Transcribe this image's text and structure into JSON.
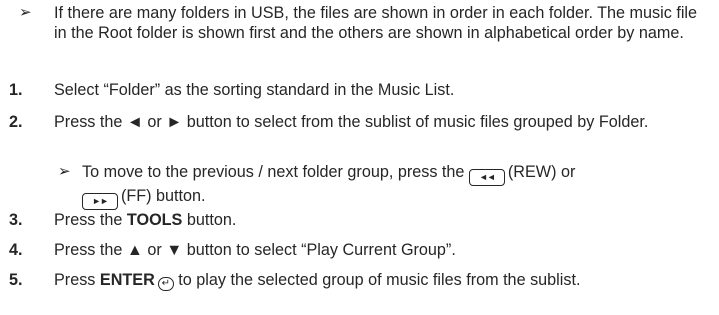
{
  "note": {
    "arrow": "➢",
    "text": "If there are many folders in USB, the files are shown in order in each folder. The music file in the Root folder is shown first and the others are shown in alphabetical order by name."
  },
  "steps": [
    {
      "num": "1.",
      "text": "Select “Folder” as the sorting standard in the Music List."
    },
    {
      "num": "2.",
      "text": "Press the ◄ or ► button to select from the sublist of music files grouped by Folder."
    },
    {
      "num": "3.",
      "pre": "Press the ",
      "bold": "TOOLS",
      "post": " button."
    },
    {
      "num": "4.",
      "text": "Press the ▲ or ▼ button to select “Play Current Group”."
    },
    {
      "num": "5.",
      "pre": "Press ",
      "bold": "ENTER",
      "post": " to play the selected group of music files from the sublist."
    }
  ],
  "subnote": {
    "arrow": "➢",
    "part1": "To move to the previous / next folder group, press the ",
    "rew_icon": "◄◄",
    "rew_label": "(REW) or",
    "ff_icon": "►►",
    "ff_label": "(FF) button."
  },
  "icons": {
    "enter": "↵"
  }
}
